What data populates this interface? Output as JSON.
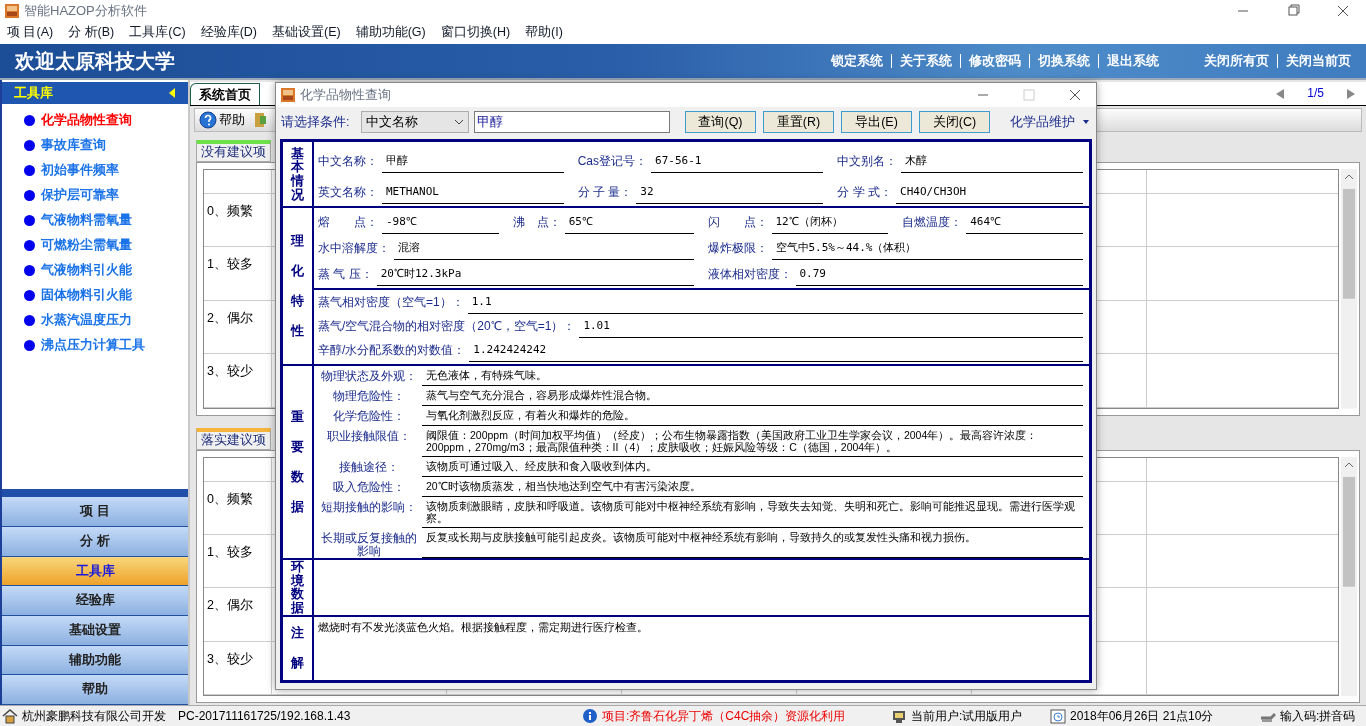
{
  "window": {
    "title": "智能HAZOP分析软件"
  },
  "menu": [
    "项 目(A)",
    "分 析(B)",
    "工具库(C)",
    "经验库(D)",
    "基础设置(E)",
    "辅助功能(G)",
    "窗口切换(H)",
    "帮助(I)"
  ],
  "banner": {
    "title": "欢迎太原科技大学",
    "links": [
      "锁定系统",
      "关于系统",
      "修改密码",
      "切换系统",
      "退出系统"
    ],
    "page_links": [
      "关闭所有页",
      "关闭当前页"
    ]
  },
  "sidebar": {
    "header": "工具库",
    "items": [
      {
        "label": "化学品物性查询",
        "selected": true
      },
      {
        "label": "事故库查询",
        "selected": false
      },
      {
        "label": "初始事件频率",
        "selected": false
      },
      {
        "label": "保护层可靠率",
        "selected": false
      },
      {
        "label": "气液物料需氧量",
        "selected": false
      },
      {
        "label": "可燃粉尘需氧量",
        "selected": false
      },
      {
        "label": "气液物料引火能",
        "selected": false
      },
      {
        "label": "固体物料引火能",
        "selected": false
      },
      {
        "label": "水蒸汽温度压力",
        "selected": false
      },
      {
        "label": "沸点压力计算工具",
        "selected": false
      }
    ],
    "sections": [
      {
        "label": "项 目",
        "selected": false
      },
      {
        "label": "分 析",
        "selected": false
      },
      {
        "label": "工具库",
        "selected": true
      },
      {
        "label": "经验库",
        "selected": false
      },
      {
        "label": "基础设置",
        "selected": false
      },
      {
        "label": "辅助功能",
        "selected": false
      },
      {
        "label": "帮助",
        "selected": false
      }
    ]
  },
  "tabs": [
    {
      "label": "系统首页",
      "selected": true
    }
  ],
  "pager": "1/5",
  "toolbar": [
    "帮助"
  ],
  "panels": [
    {
      "title": "没有建议项",
      "rows": [
        "0、频繁",
        "1、较多",
        "2、偶尔",
        "3、较少"
      ]
    },
    {
      "title": "落实建议项",
      "rows": [
        "0、频繁",
        "1、较多",
        "2、偶尔",
        "3、较少"
      ]
    }
  ],
  "dialog": {
    "title": "化学品物性查询",
    "condition_label": "请选择条件:",
    "condition": "中文名称",
    "query": "甲醇",
    "buttons": [
      "查询(Q)",
      "重置(R)",
      "导出(E)",
      "关闭(C)"
    ],
    "maintenance": "化学品维护",
    "sections": [
      {
        "heading": "基本情况",
        "groups": [
          {
            "kind": "grid",
            "rows": [
              [
                {
                  "label": "中文名称：",
                  "value": "甲醇"
                },
                {
                  "label": "Cas登记号：",
                  "value": "67-56-1"
                },
                {
                  "label": "中文别名：",
                  "value": "木醇"
                }
              ],
              [
                {
                  "label": "英文名称：",
                  "value": "METHANOL"
                },
                {
                  "label": "分 子 量：",
                  "value": "32"
                },
                {
                  "label": "分 学 式：",
                  "value": "CH4O/CH3OH"
                }
              ]
            ]
          }
        ]
      },
      {
        "heading": "理化特性",
        "groups": [
          {
            "kind": "grid",
            "rows": [
              [
                {
                  "label": "熔　　点：",
                  "value": "-98℃"
                },
                {
                  "label": "沸　点：",
                  "value": "65℃"
                },
                {
                  "label": "闪　　点：",
                  "value": "12℃（闭杯）"
                },
                {
                  "label": "自燃温度：",
                  "value": "464℃"
                }
              ],
              [
                {
                  "label": "水中溶解度：",
                  "value": "混溶"
                },
                {
                  "label": "爆炸极限：",
                  "value": "空气中5.5%～44.%（体积）"
                }
              ],
              [
                {
                  "label": "蒸 气 压：",
                  "value": "20℃时12.3kPa"
                },
                {
                  "label": "液体相对密度：",
                  "value": "0.79"
                }
              ]
            ]
          },
          {
            "kind": "lines",
            "rows": [
              {
                "label": "蒸气相对密度（空气=1）：",
                "value": "1.1"
              },
              {
                "label": "蒸气/空气混合物的相对密度（20℃，空气=1）：",
                "value": "1.01"
              },
              {
                "label": "辛醇/水分配系数的对数值：",
                "value": "1.242424242"
              }
            ]
          }
        ]
      },
      {
        "heading": "重要数据",
        "groups": [
          {
            "kind": "table",
            "rows": [
              {
                "label": "物理状态及外观：",
                "value": "无色液体，有特殊气味。"
              },
              {
                "label": "物理危险性：",
                "value": "蒸气与空气充分混合，容易形成爆炸性混合物。"
              },
              {
                "label": "化学危险性：",
                "value": "与氧化剂激烈反应，有着火和爆炸的危险。"
              },
              {
                "label": "职业接触限值：",
                "value": "阈限值：200ppm（时间加权平均值）（经皮）；公布生物暴露指数（美国政府工业卫生学家会议，2004年）。最高容许浓度：200ppm，270mg/m3；最高限值种类：II（4）；皮肤吸收；妊娠风险等级：C（德国，2004年）。"
              },
              {
                "label": "接触途径：",
                "value": "该物质可通过吸入、经皮肤和食入吸收到体内。"
              },
              {
                "label": "吸入危险性：",
                "value": "20℃时该物质蒸发，相当快地达到空气中有害污染浓度。"
              },
              {
                "label": "短期接触的影响：",
                "value": "该物质刺激眼睛，皮肤和呼吸道。该物质可能对中枢神经系统有影响，导致失去知觉、失明和死亡。影响可能推迟显现。需进行医学观察。"
              },
              {
                "label": "长期或反复接触的影响",
                "value": "反复或长期与皮肤接触可能引起皮炎。该物质可能对中枢神经系统有影响，导致持久的或复发性头痛和视力损伤。"
              }
            ]
          }
        ]
      },
      {
        "heading": "环境数据"
      },
      {
        "heading": "注解",
        "groups": [
          {
            "kind": "note",
            "text": "燃烧时有不发光淡蓝色火焰。根据接触程度，需定期进行医疗检查。"
          }
        ]
      }
    ]
  },
  "status_bar": {
    "developer": "杭州豪鹏科技有限公司开发",
    "host": "PC-201711161725/192.168.1.43",
    "project": "项目:齐鲁石化异丁烯（C4C抽余）资源化利用",
    "user": "当前用户:试用版用户",
    "datetime": "2018年06月26日 21点10分",
    "input": "输入码:拼音码"
  }
}
